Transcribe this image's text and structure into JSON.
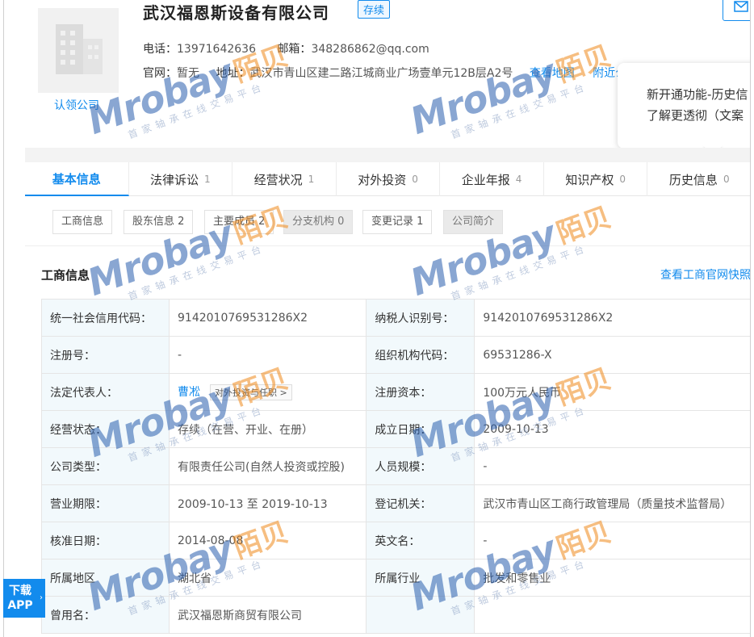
{
  "company": {
    "name": "武汉福恩斯设备有限公司",
    "status": "存续",
    "claim_label": "认领公司",
    "phone_label": "电话：",
    "phone": "13971642636",
    "email_label": "邮箱：",
    "email": "348286862@qq.com",
    "website_label": "官网：",
    "website": "暂无",
    "address_label": "地址：",
    "address": "武汉市青山区建二路江城商业广场壹单元12B层A2号",
    "map_link": "查看地图",
    "nearby_link": "附近公"
  },
  "tooltip": {
    "line1": "新开通功能-历史信",
    "line2": "了解更透彻（文案"
  },
  "main_tabs": [
    {
      "label": "基本信息",
      "count": ""
    },
    {
      "label": "法律诉讼",
      "count": "1"
    },
    {
      "label": "经营状况",
      "count": "1"
    },
    {
      "label": "对外投资",
      "count": "0"
    },
    {
      "label": "企业年报",
      "count": "4"
    },
    {
      "label": "知识产权",
      "count": "0"
    },
    {
      "label": "历史信息",
      "count": "0"
    }
  ],
  "sub_tabs": [
    {
      "label": "工商信息"
    },
    {
      "label": "股东信息 2"
    },
    {
      "label": "主要成员 2"
    },
    {
      "label": "分支机构 0"
    },
    {
      "label": "变更记录 1"
    },
    {
      "label": "公司简介"
    }
  ],
  "section": {
    "title": "工商信息",
    "link": "查看工商官网快照"
  },
  "rows": [
    {
      "k1": "统一社会信用代码：",
      "v1": "914201076953128​6X2",
      "k2": "纳税人识别号：",
      "v2": "914201076953128​6X2"
    },
    {
      "k1": "注册号：",
      "v1": "-",
      "k2": "组织机构代码：",
      "v2": "69531286-X"
    },
    {
      "k1": "法定代表人：",
      "v1": "曹凇",
      "v1_tag": "对外投资与任职 >",
      "k2": "注册资本：",
      "v2": "100万元人民币"
    },
    {
      "k1": "经营状态：",
      "v1": "存续（在营、开业、在册）",
      "k2": "成立日期：",
      "v2": "2009-10-13"
    },
    {
      "k1": "公司类型：",
      "v1": "有限责任公司(自然人投资或控股)",
      "k2": "人员规模：",
      "v2": "-"
    },
    {
      "k1": "营业期限：",
      "v1": "2009-10-13 至 2019-10-13",
      "k2": "登记机关：",
      "v2": "武汉市青山区工商行政管理局（质量技术监督局）"
    },
    {
      "k1": "核准日期：",
      "v1": "2014-08-08",
      "k2": "英文名：",
      "v2": "-"
    },
    {
      "k1": "所属地区",
      "v1": "湖北省",
      "k2": "所属行业",
      "v2": "批发和零售业"
    },
    {
      "k1": "曾用名：",
      "v1": "武汉福恩斯商贸有限公司",
      "k2": "",
      "v2": ""
    }
  ],
  "download": {
    "line1": "下载",
    "line2": "APP"
  },
  "watermark": {
    "brand": "Mrobay",
    "cn": "陌贝",
    "slogan": "首家轴承在线交易平台"
  },
  "colors": {
    "accent": "#128bed",
    "key_bg": "#f2f9fc",
    "watermark_blue": "#2a5fae",
    "watermark_orange": "#f08a1c"
  }
}
